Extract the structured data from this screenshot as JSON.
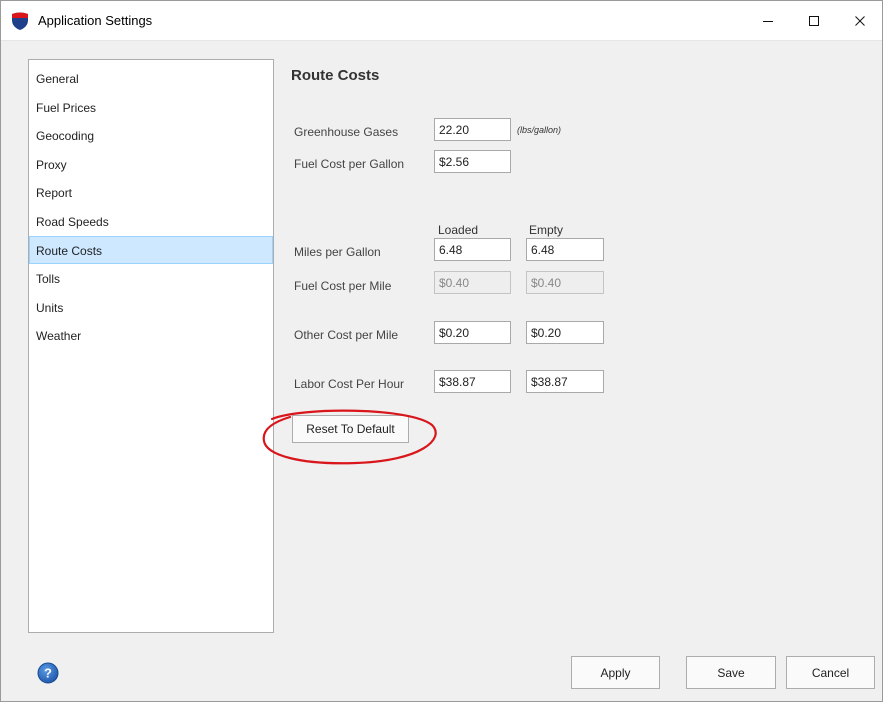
{
  "window": {
    "title": "Application Settings",
    "controls": {
      "minimize": "—",
      "maximize": "☐",
      "close": "✕"
    }
  },
  "sidebar": {
    "items": [
      {
        "label": "General",
        "selected": false
      },
      {
        "label": "Fuel Prices",
        "selected": false
      },
      {
        "label": "Geocoding",
        "selected": false
      },
      {
        "label": "Proxy",
        "selected": false
      },
      {
        "label": "Report",
        "selected": false
      },
      {
        "label": "Road Speeds",
        "selected": false
      },
      {
        "label": "Route Costs",
        "selected": true
      },
      {
        "label": "Tolls",
        "selected": false
      },
      {
        "label": "Units",
        "selected": false
      },
      {
        "label": "Weather",
        "selected": false
      }
    ]
  },
  "route_costs": {
    "title": "Route Costs",
    "greenhouse": {
      "label": "Greenhouse Gases",
      "value": "22.20",
      "unit": "(lbs/gallon)"
    },
    "fuel_cost_gallon": {
      "label": "Fuel Cost per Gallon",
      "value": "$2.56"
    },
    "columns": {
      "loaded": "Loaded",
      "empty": "Empty"
    },
    "mpg": {
      "label": "Miles per Gallon",
      "loaded": "6.48",
      "empty": "6.48"
    },
    "fuel_cost_mile": {
      "label": "Fuel Cost per Mile",
      "loaded": "$0.40",
      "empty": "$0.40"
    },
    "other_cost_mile": {
      "label": "Other Cost per Mile",
      "loaded": "$0.20",
      "empty": "$0.20"
    },
    "labor_cost_hour": {
      "label": "Labor Cost Per Hour",
      "loaded": "$38.87",
      "empty": "$38.87"
    },
    "reset_label": "Reset To Default"
  },
  "footer": {
    "help_label": "?",
    "apply_label": "Apply",
    "save_label": "Save",
    "cancel_label": "Cancel"
  },
  "colors": {
    "selection": "#cde8ff",
    "annotation_ring": "#d8161b",
    "help_icon": "#2b6cc4"
  }
}
